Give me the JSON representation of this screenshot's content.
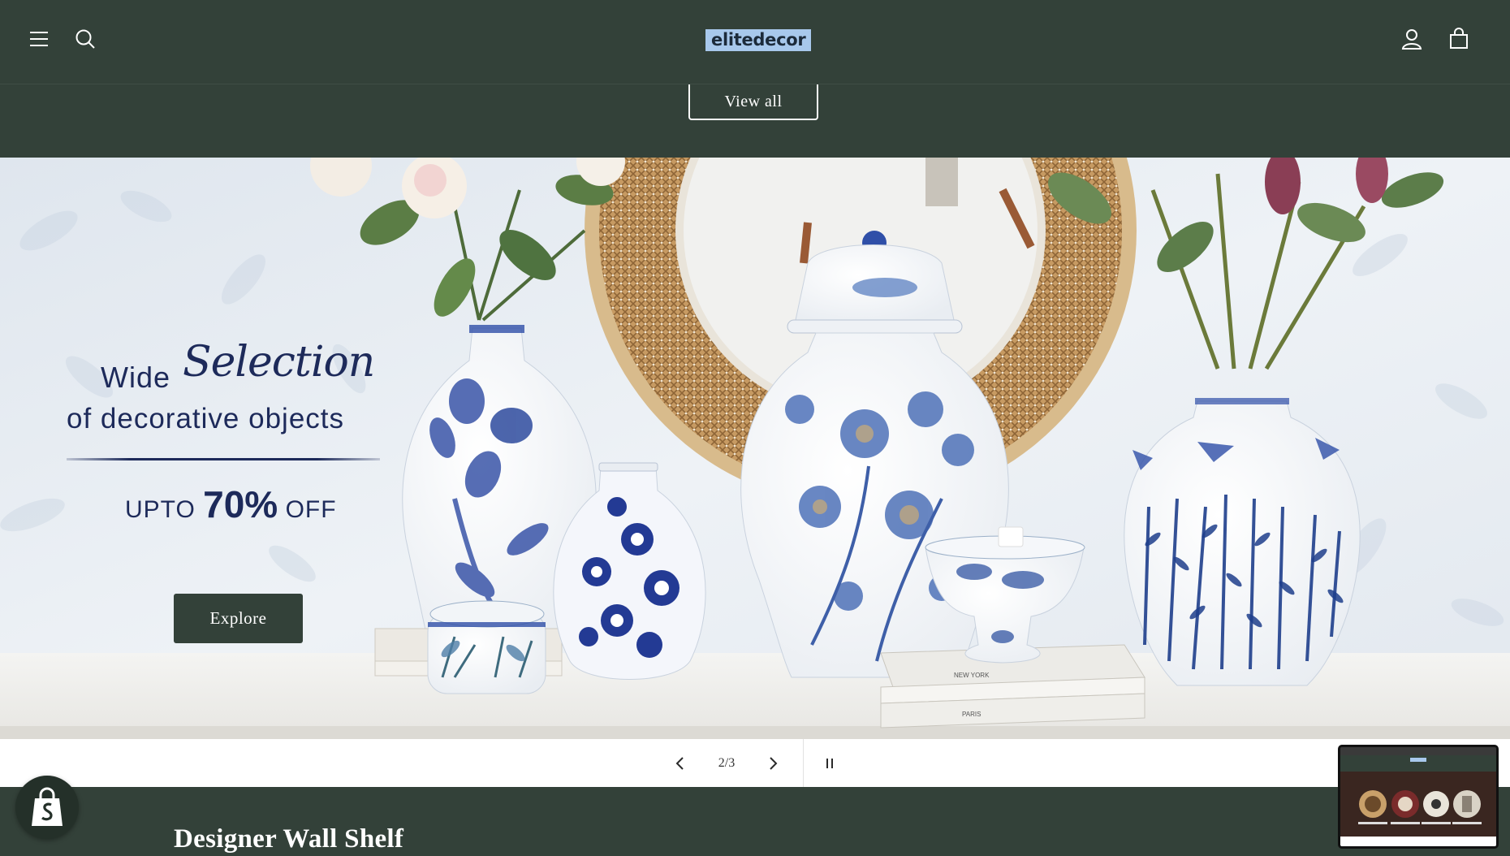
{
  "header": {
    "logo_text": "elitedecor",
    "icons": [
      "menu-icon",
      "search-icon",
      "account-icon",
      "cart-icon"
    ]
  },
  "collection": {
    "view_all_label": "View all"
  },
  "hero": {
    "promo_line1": "Wide",
    "promo_script": "Selection",
    "promo_line2": "of decorative objects",
    "promo_upto": "UPTO",
    "promo_percent": "70%",
    "promo_off": "OFF",
    "cta_label": "Explore",
    "book_top_label": "NEW YORK",
    "book_bottom_label": "PARIS"
  },
  "slider": {
    "counter": "2/3",
    "current_slide": 2,
    "total_slides": 3,
    "icons": [
      "chevron-left-icon",
      "chevron-right-icon",
      "pause-icon"
    ]
  },
  "next_section": {
    "title": "Designer Wall Shelf"
  },
  "colors": {
    "brand_dark_green": "#334139",
    "logo_highlight": "#a8c8ec",
    "promo_navy": "#1d2a5a",
    "porcelain_blue": "#2f4fa8"
  }
}
